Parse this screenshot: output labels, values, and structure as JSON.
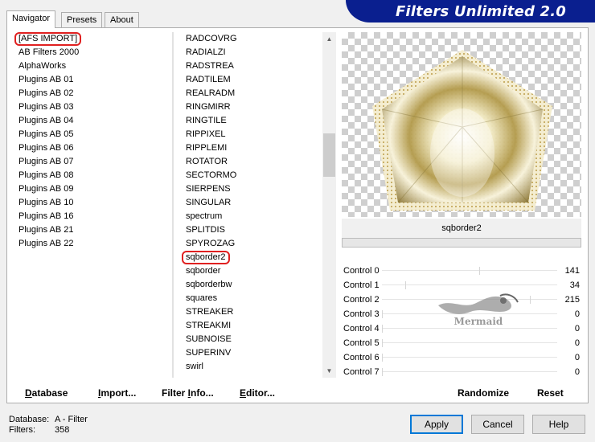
{
  "tabs": [
    {
      "label": "Navigator",
      "active": true
    },
    {
      "label": "Presets",
      "active": false
    },
    {
      "label": "About",
      "active": false
    }
  ],
  "banner": {
    "title": "Filters Unlimited 2.0",
    "color": "#0a1f8f"
  },
  "categories": [
    "[AFS IMPORT]",
    "AB Filters 2000",
    "AlphaWorks",
    "Plugins AB 01",
    "Plugins AB 02",
    "Plugins AB 03",
    "Plugins AB 04",
    "Plugins AB 05",
    "Plugins AB 06",
    "Plugins AB 07",
    "Plugins AB 08",
    "Plugins AB 09",
    "Plugins AB 10",
    "Plugins AB 16",
    "Plugins AB 21",
    "Plugins AB 22"
  ],
  "selected_category": "[AFS IMPORT]",
  "filters": [
    "RADCOVRG",
    "RADIALZI",
    "RADSTREA",
    "RADTILEM",
    "REALRADM",
    "RINGMIRR",
    "RINGTILE",
    "RIPPIXEL",
    "RIPPLEMI",
    "ROTATOR",
    "SECTORMO",
    "SIERPENS",
    "SINGULAR",
    "spectrum",
    "SPLITDIS",
    "SPYROZAG",
    "sqborder2",
    "sqborder",
    "sqborderbw",
    "squares",
    "STREAKER",
    "STREAKMI",
    "SUBNOISE",
    "SUPERINV",
    "swirl"
  ],
  "selected_filter": "sqborder2",
  "preview": {
    "filter_name": "sqborder2",
    "progress": 0
  },
  "controls": [
    {
      "label": "Control 0",
      "value": 141
    },
    {
      "label": "Control 1",
      "value": 34
    },
    {
      "label": "Control 2",
      "value": 215
    },
    {
      "label": "Control 3",
      "value": 0
    },
    {
      "label": "Control 4",
      "value": 0
    },
    {
      "label": "Control 5",
      "value": 0
    },
    {
      "label": "Control 6",
      "value": 0
    },
    {
      "label": "Control 7",
      "value": 0
    }
  ],
  "watermark_text": "Mermaid",
  "buttons_left": {
    "database": {
      "underline": "D",
      "rest": "atabase"
    },
    "import": {
      "underline": "I",
      "rest": "mport..."
    },
    "filter_info": {
      "pre": "Filter ",
      "underline": "I",
      "rest": "nfo..."
    },
    "editor": {
      "underline": "E",
      "rest": "ditor..."
    }
  },
  "buttons_right": {
    "randomize": "Randomize",
    "reset": "Reset"
  },
  "status": {
    "database_label": "Database:",
    "database_value": "A - Filter",
    "filters_label": "Filters:",
    "filters_value": "358"
  },
  "dialog": {
    "apply": "Apply",
    "cancel": "Cancel",
    "help": "Help"
  },
  "colors": {
    "highlight": "#e02020",
    "gold": "#c9b467",
    "accent": "#0078d7"
  }
}
